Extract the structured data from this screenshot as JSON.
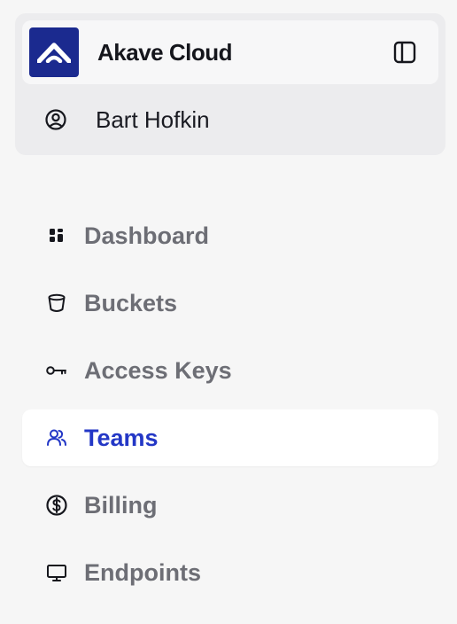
{
  "brand": {
    "name": "Akave Cloud",
    "logo_color": "#1b2a8f"
  },
  "user": {
    "name": "Bart Hofkin",
    "icon": "user-circle-icon"
  },
  "nav": {
    "items": [
      {
        "label": "Dashboard",
        "icon": "dashboard-icon",
        "active": false
      },
      {
        "label": "Buckets",
        "icon": "bucket-icon",
        "active": false
      },
      {
        "label": "Access Keys",
        "icon": "key-icon",
        "active": false
      },
      {
        "label": "Teams",
        "icon": "users-icon",
        "active": true
      },
      {
        "label": "Billing",
        "icon": "dollar-circle-icon",
        "active": false
      },
      {
        "label": "Endpoints",
        "icon": "monitor-icon",
        "active": false
      }
    ]
  },
  "colors": {
    "active": "#2337c6",
    "inactive": "#6d6e75"
  }
}
